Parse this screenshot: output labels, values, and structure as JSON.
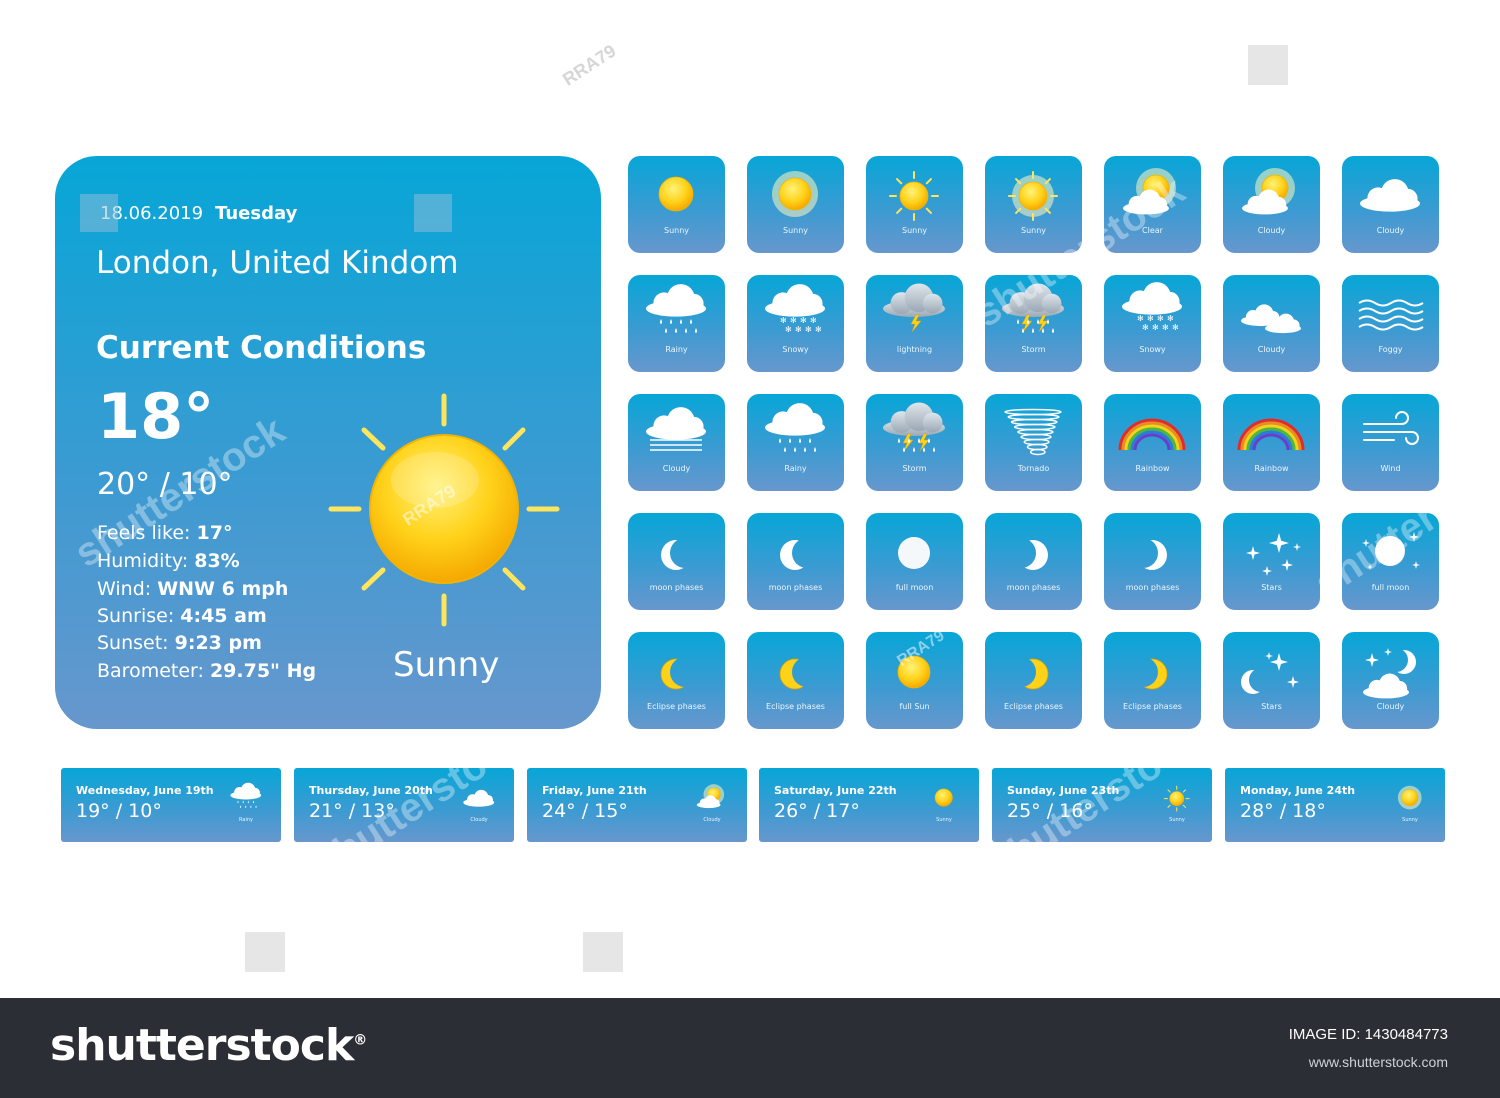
{
  "current": {
    "date": "18.06.2019",
    "day": "Tuesday",
    "location": "London, United Kindom",
    "heading": "Current Conditions",
    "temp": "18°",
    "range": "20° / 10°",
    "details": [
      {
        "label": "Feels like: ",
        "value": "17°"
      },
      {
        "label": "Humidity: ",
        "value": "83%"
      },
      {
        "label": "Wind: ",
        "value": "WNW 6 mph"
      },
      {
        "label": "Sunrise: ",
        "value": "4:45 am"
      },
      {
        "label": "Sunset: ",
        "value": "9:23 pm"
      },
      {
        "label": "Barometer: ",
        "value": "29.75\" Hg"
      }
    ],
    "condition": "Sunny",
    "condition_icon": "sun-icon"
  },
  "icons": [
    [
      {
        "label": "Sunny",
        "icon": "sun"
      },
      {
        "label": "Sunny",
        "icon": "sun-glow"
      },
      {
        "label": "Sunny",
        "icon": "sun-rays"
      },
      {
        "label": "Sunny",
        "icon": "sun-glow-rays"
      },
      {
        "label": "Clear",
        "icon": "sun-cloud"
      },
      {
        "label": "Cloudy",
        "icon": "sun-cloud"
      },
      {
        "label": "Cloudy",
        "icon": "cloud"
      }
    ],
    [
      {
        "label": "Rainy",
        "icon": "rain"
      },
      {
        "label": "Snowy",
        "icon": "snow"
      },
      {
        "label": "lightning",
        "icon": "lightning"
      },
      {
        "label": "Storm",
        "icon": "storm"
      },
      {
        "label": "Snowy",
        "icon": "heavy-snow"
      },
      {
        "label": "Cloudy",
        "icon": "clouds"
      },
      {
        "label": "Foggy",
        "icon": "fog"
      }
    ],
    [
      {
        "label": "Cloudy",
        "icon": "cloud-fog"
      },
      {
        "label": "Rainy",
        "icon": "rain"
      },
      {
        "label": "Storm",
        "icon": "storm"
      },
      {
        "label": "Tornado",
        "icon": "tornado"
      },
      {
        "label": "Rainbow",
        "icon": "rainbow"
      },
      {
        "label": "Rainbow",
        "icon": "rainbow"
      },
      {
        "label": "Wind",
        "icon": "wind"
      }
    ],
    [
      {
        "label": "moon phases",
        "icon": "crescent-left"
      },
      {
        "label": "moon phases",
        "icon": "crescent-left-wide"
      },
      {
        "label": "full moon",
        "icon": "full-moon"
      },
      {
        "label": "moon phases",
        "icon": "crescent-right-wide"
      },
      {
        "label": "moon phases",
        "icon": "crescent-right"
      },
      {
        "label": "Stars",
        "icon": "stars"
      },
      {
        "label": "full moon",
        "icon": "full-moon-stars"
      }
    ],
    [
      {
        "label": "Eclipse phases",
        "icon": "eclipse-left"
      },
      {
        "label": "Eclipse phases",
        "icon": "eclipse-left-wide"
      },
      {
        "label": "full Sun",
        "icon": "full-sun"
      },
      {
        "label": "Eclipse phases",
        "icon": "eclipse-right-wide"
      },
      {
        "label": "Eclipse phases",
        "icon": "eclipse-right"
      },
      {
        "label": "Stars",
        "icon": "moon-stars"
      },
      {
        "label": "Cloudy",
        "icon": "night-cloud"
      }
    ]
  ],
  "forecast": [
    {
      "day": "Wednesday, June 19th",
      "temp": "19° / 10°",
      "condition": "Rainy",
      "icon": "rain"
    },
    {
      "day": "Thursday, June 20th",
      "temp": "21° / 13°",
      "condition": "Cloudy",
      "icon": "cloud"
    },
    {
      "day": "Friday, June 21th",
      "temp": "24° / 15°",
      "condition": "Cloudy",
      "icon": "sun-cloud"
    },
    {
      "day": "Saturday, June 22th",
      "temp": "26° / 17°",
      "condition": "Sunny",
      "icon": "sun"
    },
    {
      "day": "Sunday, June 23th",
      "temp": "25° / 16°",
      "condition": "Sunny",
      "icon": "sun-rays"
    },
    {
      "day": "Monday, June 24th",
      "temp": "28° / 18°",
      "condition": "Sunny",
      "icon": "sun-glow"
    }
  ],
  "watermark": {
    "logo": "shutterstock",
    "mark": "®",
    "image_id_label": "IMAGE ID: ",
    "image_id": "1430484773",
    "url": "www.shutterstock.com",
    "overlay_text": "shutterstock",
    "artist": "RRA79"
  },
  "colors": {
    "tile_top": "#07a6d7",
    "tile_bottom": "#6797cd",
    "sun": "#ffd21a",
    "sun_dark": "#f5a800",
    "cloud": "#ffffff",
    "bar": "#2b2e35"
  }
}
